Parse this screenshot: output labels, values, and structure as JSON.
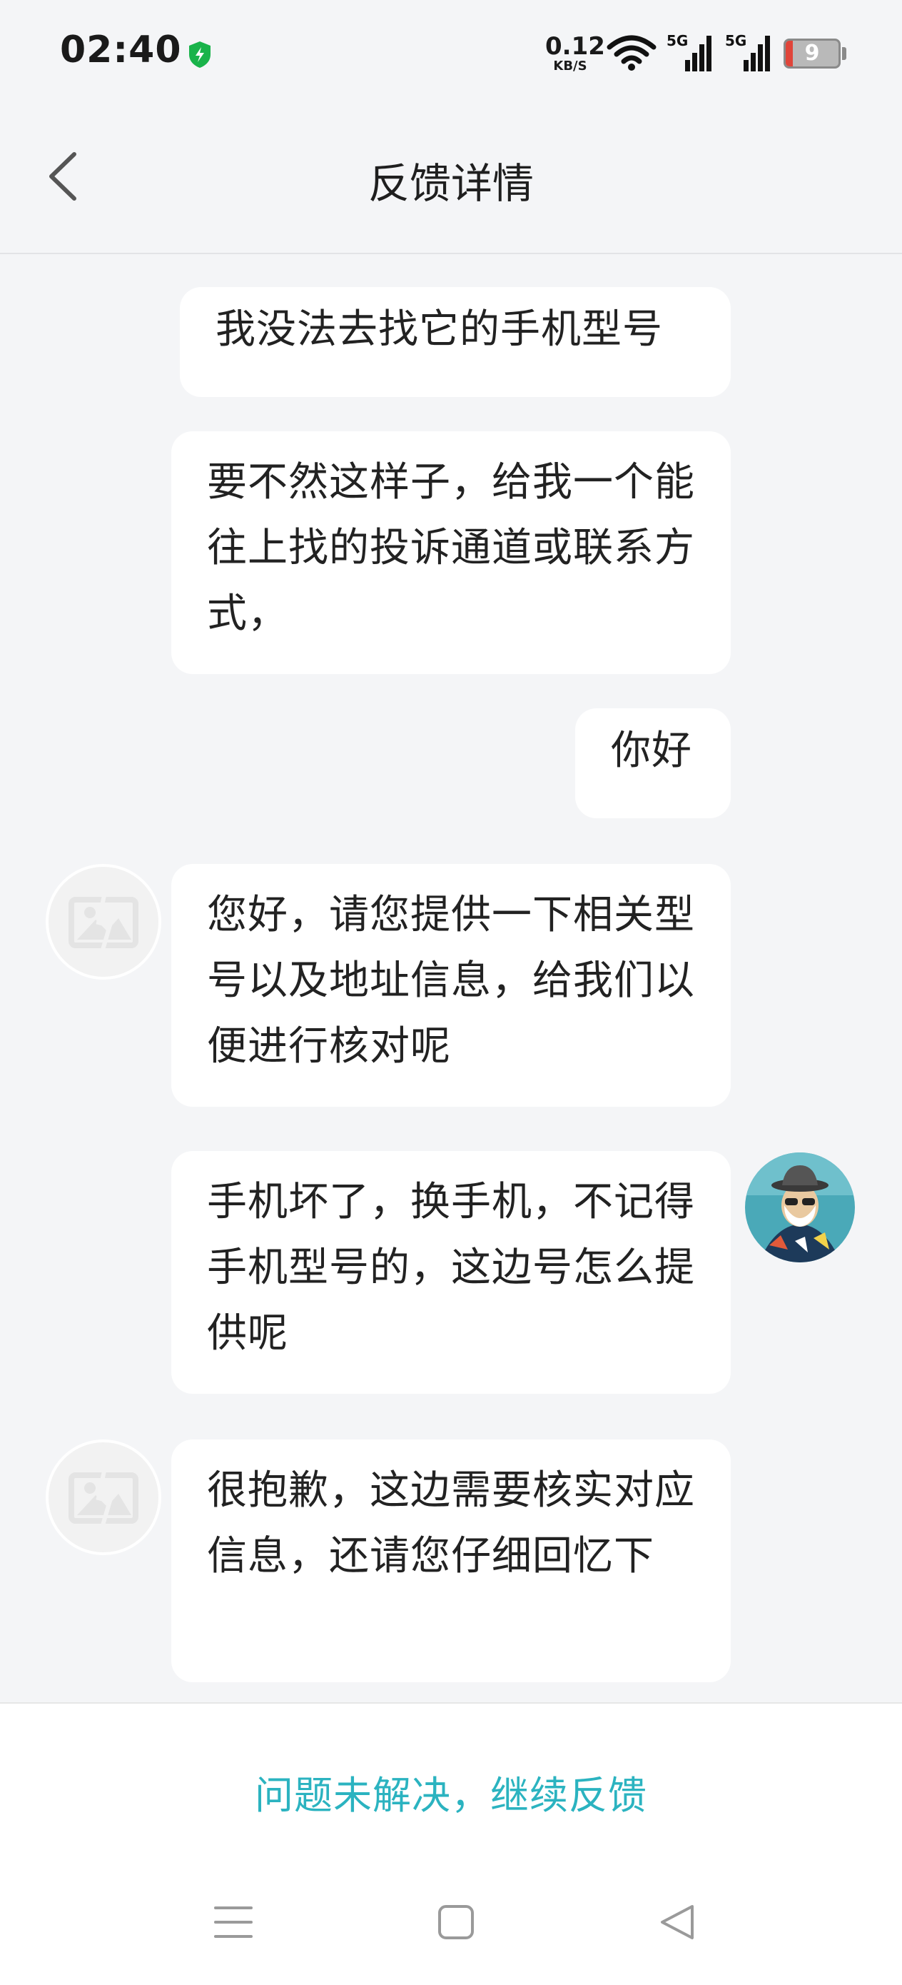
{
  "status_bar": {
    "time": "02:40",
    "net_speed_value": "0.12",
    "net_speed_unit": "KB/S",
    "signal_1": "5G",
    "signal_2": "5G",
    "battery_level": "9",
    "icons": [
      "shield-check-icon",
      "wifi-icon",
      "signal-5g-icon",
      "signal-5g-icon",
      "battery-icon"
    ]
  },
  "header": {
    "title": "反馈详情",
    "back_icon": "chevron-left-icon"
  },
  "messages": [
    {
      "sender": "user",
      "text": "我没法去找它的手机型号",
      "avatar": false
    },
    {
      "sender": "user",
      "text": "要不然这样子，给我一个能往上找的投诉通道或联系方式，",
      "avatar": false
    },
    {
      "sender": "user",
      "text": "你好",
      "avatar": false
    },
    {
      "sender": "agent",
      "text": "您好，请您提供一下相关型号以及地址信息，给我们以便进行核对呢",
      "avatar": true
    },
    {
      "sender": "user",
      "text": "手机坏了，换手机，不记得手机型号的，这边号怎么提供呢",
      "avatar": true
    },
    {
      "sender": "agent",
      "text": "很抱歉，这边需要核实对应信息，还请您仔细回忆下",
      "avatar": true
    }
  ],
  "footer": {
    "continue_label": "问题未解决，继续反馈",
    "nav_icons": [
      "menu-icon",
      "home-square-icon",
      "back-triangle-icon"
    ]
  },
  "colors": {
    "background": "#f4f5f7",
    "bubble": "#ffffff",
    "accent": "#2bb3c0"
  }
}
